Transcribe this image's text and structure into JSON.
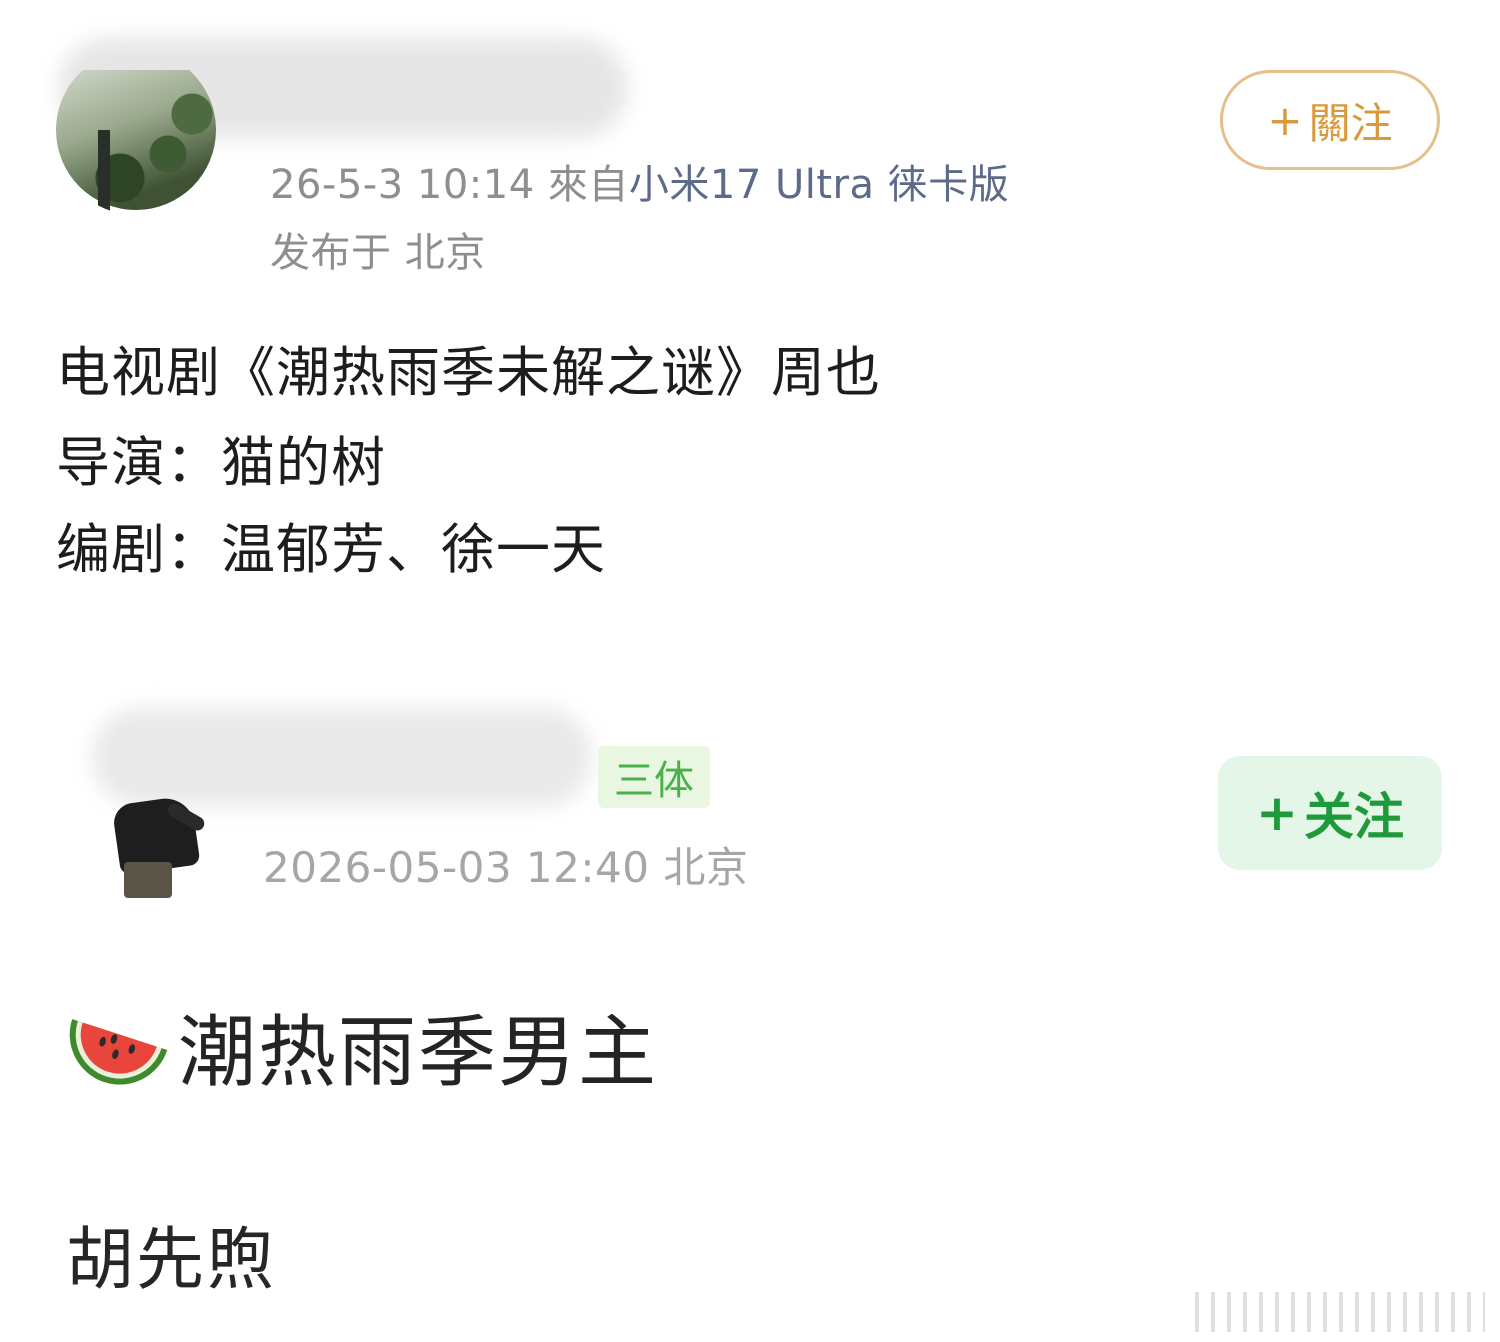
{
  "posts": [
    {
      "time": "26-5-3 10:14",
      "source_prefix": "來自",
      "device": "小米17 Ultra 徕卡版",
      "location": "发布于 北京",
      "follow_label": "關注",
      "follow_plus": "+",
      "content": [
        "电视剧《潮热雨季未解之谜》周也",
        "导演：猫的树",
        "编剧：温郁芳、徐一天"
      ]
    },
    {
      "tag": "三体",
      "time_location": "2026-05-03 12:40  北京",
      "follow_label": "关注",
      "follow_plus": "+",
      "headline": "潮热雨季男主",
      "answer": "胡先煦"
    }
  ],
  "colors": {
    "follow_outline": "#d99a3b",
    "follow_green": "#1f9a3b",
    "tag_green": "#4ab04a",
    "device_link": "#5c6b8a"
  },
  "icons": {
    "headline_emoji": "watermelon-icon"
  }
}
